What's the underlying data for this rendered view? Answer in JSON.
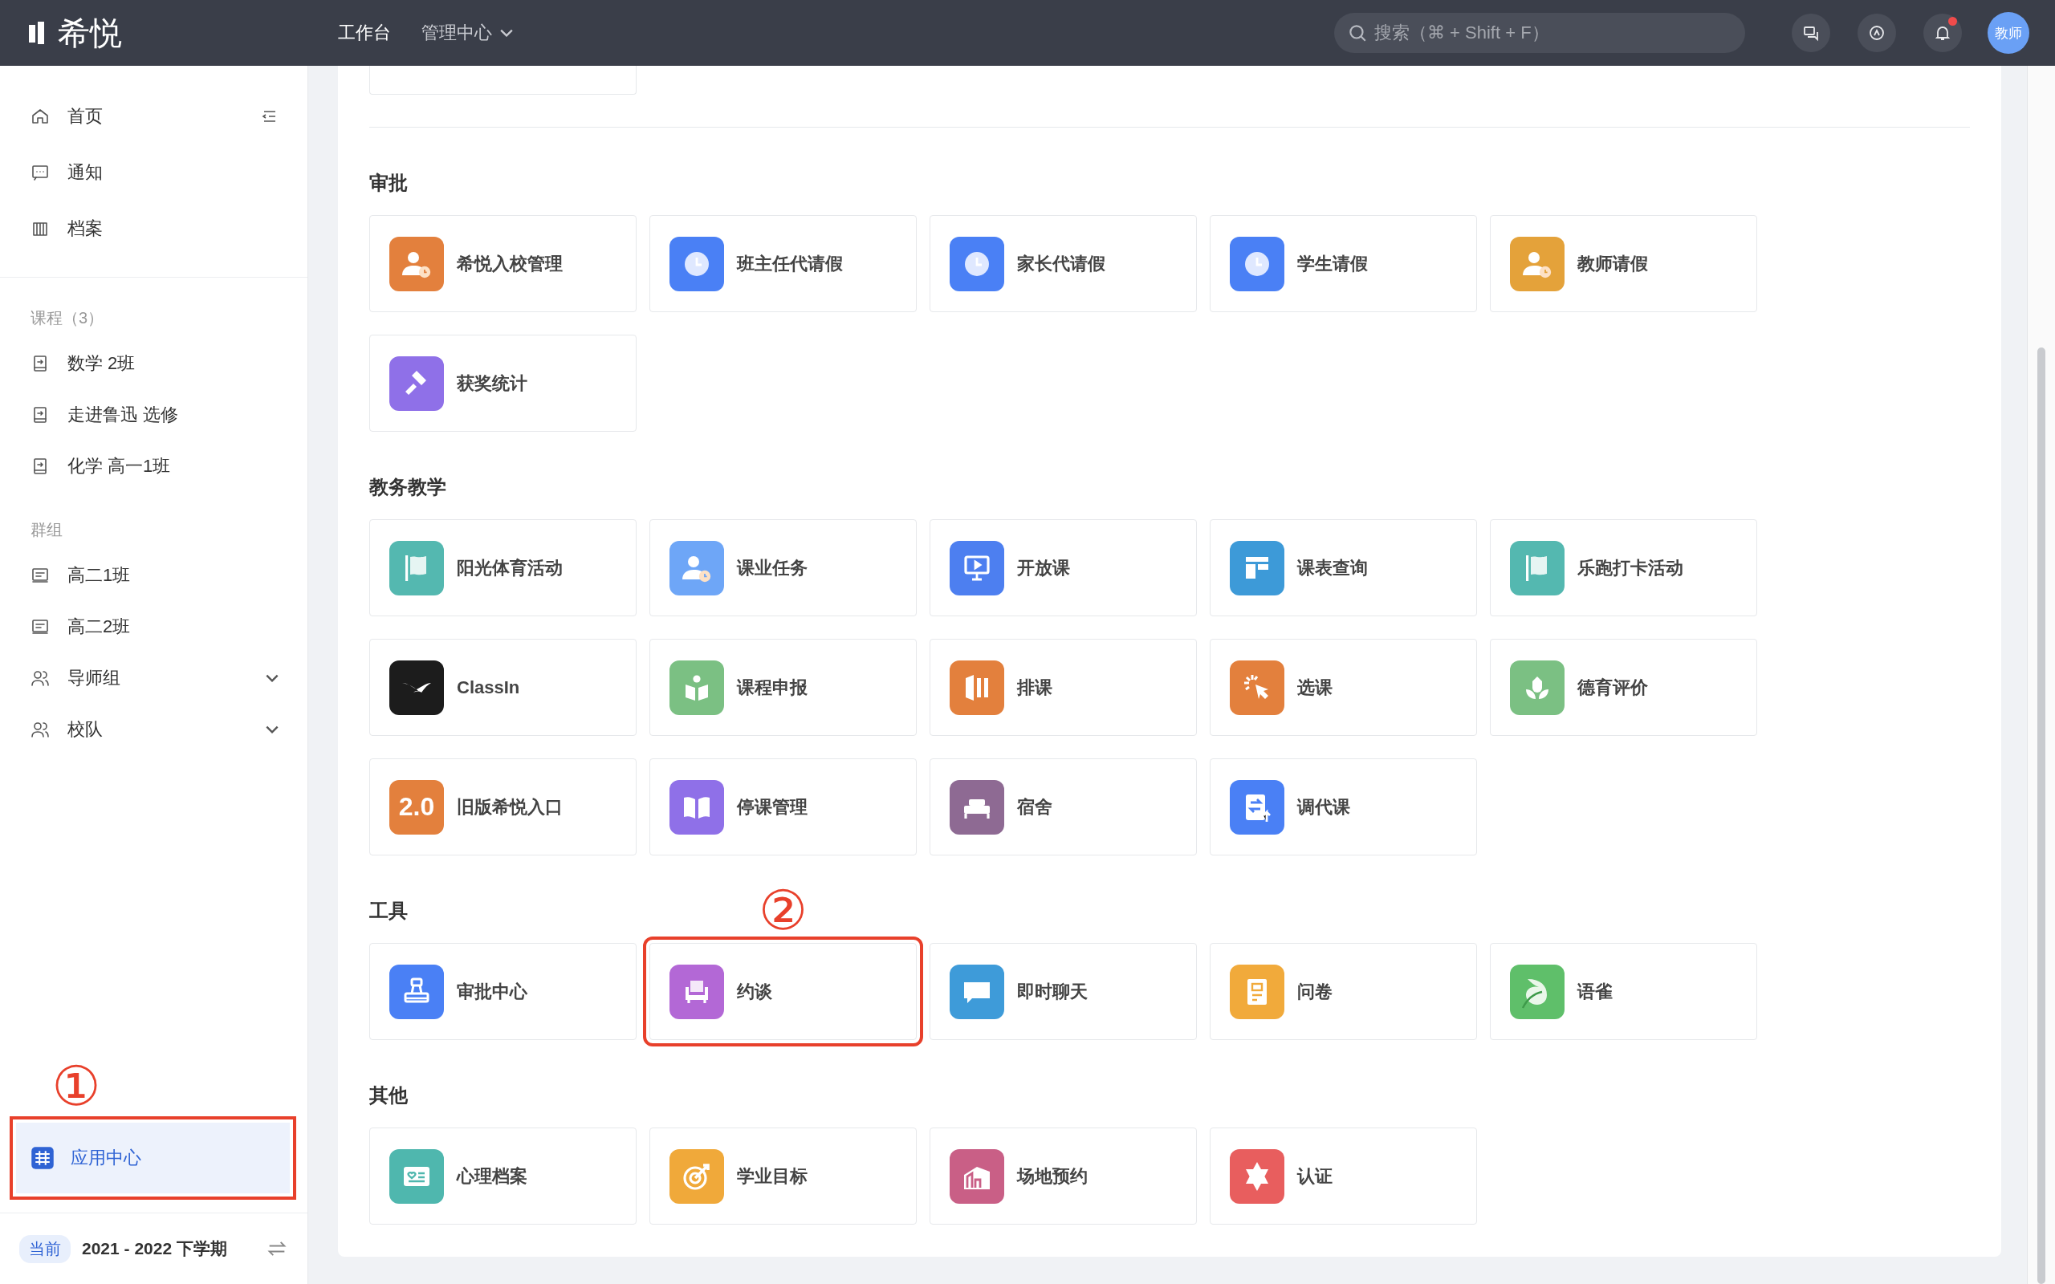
{
  "topbar": {
    "logo": "希悦",
    "nav": [
      {
        "label": "工作台",
        "selected": true,
        "dropdown": false
      },
      {
        "label": "管理中心",
        "selected": false,
        "dropdown": true
      }
    ],
    "search": {
      "placeholder": "搜索（⌘ + Shift + F）"
    },
    "notification_dot": true,
    "avatar": "教师"
  },
  "sidebar": {
    "nav": [
      {
        "label": "首页",
        "kind": "home"
      },
      {
        "label": "通知",
        "kind": "message"
      },
      {
        "label": "档案",
        "kind": "archive"
      }
    ],
    "groups": [
      {
        "title": "课程（3）",
        "items": [
          {
            "label": "数学 2班",
            "kind": "course",
            "expandable": false
          },
          {
            "label": "走进鲁迅 选修",
            "kind": "course",
            "expandable": false
          },
          {
            "label": "化学 高一1班",
            "kind": "course",
            "expandable": false
          }
        ]
      },
      {
        "title": "群组",
        "items": [
          {
            "label": "高二1班",
            "kind": "board",
            "expandable": false
          },
          {
            "label": "高二2班",
            "kind": "board",
            "expandable": false
          },
          {
            "label": "导师组",
            "kind": "people",
            "expandable": true
          },
          {
            "label": "校队",
            "kind": "people",
            "expandable": true
          }
        ]
      }
    ],
    "app_center": {
      "label": "应用中心",
      "selected": true,
      "annotation": "①"
    },
    "term": {
      "badge": "当前",
      "label": "2021 - 2022 下学期"
    }
  },
  "sections": [
    {
      "title": "审批",
      "apps": [
        {
          "name": "希悦入校管理",
          "kind": "person-clock",
          "color": "#e3803d"
        },
        {
          "name": "班主任代请假",
          "kind": "clock",
          "color": "#4a80f5"
        },
        {
          "name": "家长代请假",
          "kind": "clock",
          "color": "#4a80f5"
        },
        {
          "name": "学生请假",
          "kind": "clock",
          "color": "#4a80f5"
        },
        {
          "name": "教师请假",
          "kind": "person-clock",
          "color": "#e4a23a"
        },
        {
          "name": "获奖统计",
          "kind": "gavel",
          "color": "#8f70e8"
        }
      ]
    },
    {
      "title": "教务教学",
      "apps": [
        {
          "name": "阳光体育活动",
          "kind": "flag",
          "color": "#54b8b0"
        },
        {
          "name": "课业任务",
          "kind": "person-clock",
          "color": "#6ea6f7"
        },
        {
          "name": "开放课",
          "kind": "monitor",
          "color": "#4d7ff0"
        },
        {
          "name": "课表查询",
          "kind": "layout",
          "color": "#3d9ad8"
        },
        {
          "name": "乐跑打卡活动",
          "kind": "flag",
          "color": "#54b8b0"
        },
        {
          "name": "ClassIn",
          "kind": "wing",
          "color": "#1c1c1c"
        },
        {
          "name": "课程申报",
          "kind": "reader",
          "color": "#7bc083"
        },
        {
          "name": "排课",
          "kind": "bars",
          "color": "#e3803d"
        },
        {
          "name": "选课",
          "kind": "cursor",
          "color": "#e3803d"
        },
        {
          "name": "德育评价",
          "kind": "flower",
          "color": "#7bc083"
        },
        {
          "name": "旧版希悦入口",
          "kind": "text",
          "icon_text": "2.0",
          "color": "#e3803d"
        },
        {
          "name": "停课管理",
          "kind": "book",
          "color": "#8f70e8"
        },
        {
          "name": "宿舍",
          "kind": "bed",
          "color": "#8e6a93"
        },
        {
          "name": "调代课",
          "kind": "swap",
          "color": "#4a80f5"
        }
      ]
    },
    {
      "title": "工具",
      "apps": [
        {
          "name": "审批中心",
          "kind": "stamp",
          "color": "#4a80f5"
        },
        {
          "name": "约谈",
          "kind": "sofa",
          "color": "#b368d6",
          "annotation": "②"
        },
        {
          "name": "即时聊天",
          "kind": "chat",
          "color": "#3e9bd9"
        },
        {
          "name": "问卷",
          "kind": "doc",
          "color": "#f1aa3b"
        },
        {
          "name": "语雀",
          "kind": "leaf",
          "color": "#5fbf6a"
        }
      ]
    },
    {
      "title": "其他",
      "apps": [
        {
          "name": "心理档案",
          "kind": "idcard",
          "color": "#4fb7ae"
        },
        {
          "name": "学业目标",
          "kind": "target",
          "color": "#f0a93a"
        },
        {
          "name": "场地预约",
          "kind": "house",
          "color": "#c95f86"
        },
        {
          "name": "认证",
          "kind": "star",
          "color": "#e85e5e"
        }
      ]
    }
  ]
}
